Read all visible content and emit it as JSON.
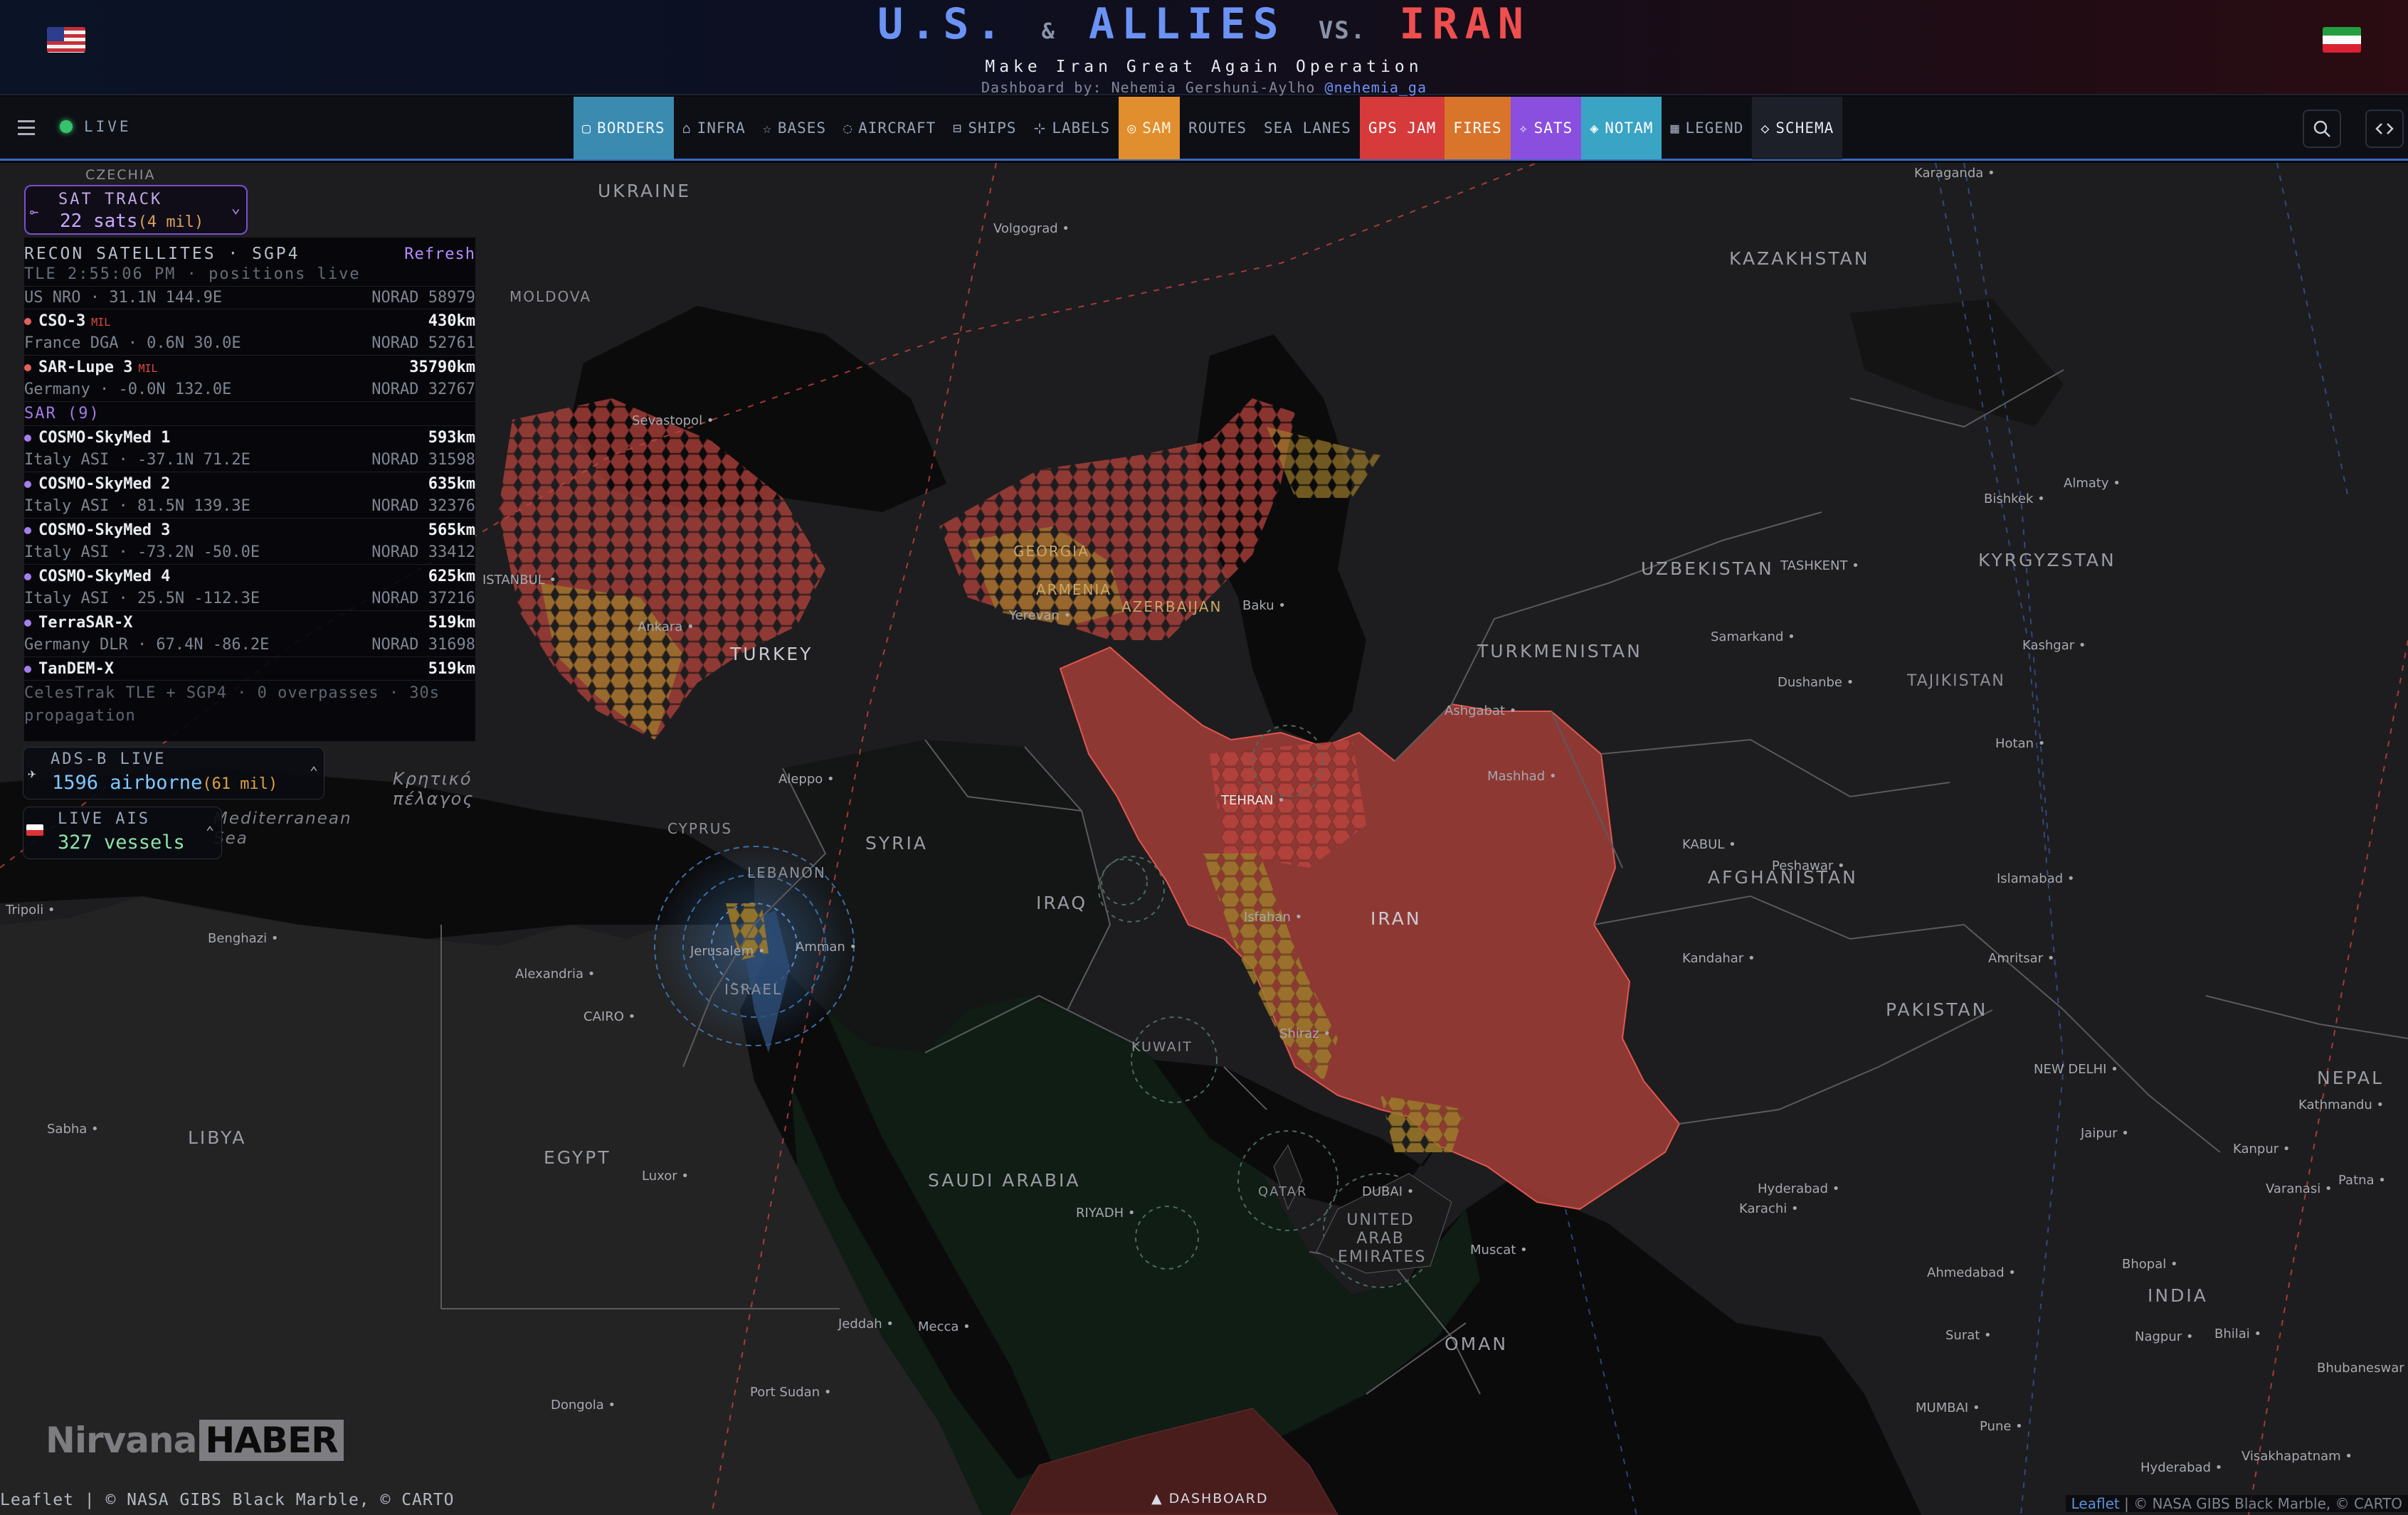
{
  "header": {
    "title_us": "U.S.",
    "title_amp": "&",
    "title_allies": "ALLIES",
    "title_vs": "VS.",
    "title_iran": "IRAN",
    "subtitle": "Make Iran Great Again Operation",
    "byline_prefix": "Dashboard by: Nehemia Gershuni-Aylho",
    "byline_handle": "@nehemia_ga"
  },
  "toolbar": {
    "live": "LIVE",
    "tabs": [
      {
        "label": "BORDERS",
        "icon": "▢"
      },
      {
        "label": "INFRA",
        "icon": "⌂"
      },
      {
        "label": "BASES",
        "icon": "☆"
      },
      {
        "label": "AIRCRAFT",
        "icon": "◌"
      },
      {
        "label": "SHIPS",
        "icon": "⊟"
      },
      {
        "label": "LABELS",
        "icon": "⊹"
      },
      {
        "label": "SAM",
        "icon": "◎"
      },
      {
        "label": "ROUTES",
        "icon": ""
      },
      {
        "label": "SEA LANES",
        "icon": ""
      },
      {
        "label": "GPS JAM",
        "icon": ""
      },
      {
        "label": "FIRES",
        "icon": ""
      },
      {
        "label": "SATS",
        "icon": "✧"
      },
      {
        "label": "NOTAM",
        "icon": "◈"
      },
      {
        "label": "LEGEND",
        "icon": "▦"
      },
      {
        "label": "SCHEMA",
        "icon": "◇"
      }
    ],
    "search_icon": "search-icon",
    "code_icon": "code-icon"
  },
  "sat_track": {
    "label": "SAT TRACK",
    "count": "22 sats",
    "mil": "(4 mil)"
  },
  "recon": {
    "title": "RECON SATELLITES · SGP4",
    "refresh": "Refresh",
    "tle": "TLE 2:55:06 PM · positions live",
    "top": {
      "detail": "US NRO · 31.1N 144.9E",
      "norad": "NORAD 58979"
    },
    "mil_sats": [
      {
        "name": "CSO-3",
        "tag": "MIL",
        "km": "430km",
        "detail": "France DGA · 0.6N 30.0E",
        "norad": "NORAD 52761"
      },
      {
        "name": "SAR-Lupe 3",
        "tag": "MIL",
        "km": "35790km",
        "detail": "Germany · -0.0N 132.0E",
        "norad": "NORAD 32767"
      }
    ],
    "sar_header": "SAR (9)",
    "sar_sats": [
      {
        "name": "COSMO-SkyMed 1",
        "km": "593km",
        "detail": "Italy ASI · -37.1N 71.2E",
        "norad": "NORAD 31598"
      },
      {
        "name": "COSMO-SkyMed 2",
        "km": "635km",
        "detail": "Italy ASI · 81.5N 139.3E",
        "norad": "NORAD 32376"
      },
      {
        "name": "COSMO-SkyMed 3",
        "km": "565km",
        "detail": "Italy ASI · -73.2N -50.0E",
        "norad": "NORAD 33412"
      },
      {
        "name": "COSMO-SkyMed 4",
        "km": "625km",
        "detail": "Italy ASI · 25.5N -112.3E",
        "norad": "NORAD 37216"
      },
      {
        "name": "TerraSAR-X",
        "km": "519km",
        "detail": "Germany DLR · 67.4N -86.2E",
        "norad": "NORAD 31698"
      },
      {
        "name": "TanDEM-X",
        "km": "519km"
      }
    ],
    "footer": "CelesTrak TLE + SGP4 · 0 overpasses · 30s propagation"
  },
  "adsb": {
    "label": "ADS-B LIVE",
    "count": "1596 airborne",
    "mil": "(61 mil)"
  },
  "ais": {
    "label": "LIVE AIS",
    "count": "327 vessels"
  },
  "map": {
    "countries": [
      "UKRAINE",
      "CZECHIA",
      "MOLDOVA",
      "KAZAKHSTAN",
      "UZBEKISTAN",
      "TURKMENISTAN",
      "KYRGYZSTAN",
      "TAJIKISTAN",
      "AFGHANISTAN",
      "PAKISTAN",
      "TURKEY",
      "GEORGIA",
      "ARMENIA",
      "AZERBAIJAN",
      "SYRIA",
      "IRAQ",
      "IRAN",
      "LEBANON",
      "ISRAEL",
      "CYPRUS",
      "KUWAIT",
      "QATAR",
      "UNITED ARAB EMIRATES",
      "SAUDI ARABIA",
      "OMAN",
      "EGYPT",
      "LIBYA",
      "INDIA",
      "NEPAL"
    ],
    "cities": [
      "Volgograd",
      "Karaganda",
      "Sevastopol",
      "Ankara",
      "ISTANBUL",
      "Yerevan",
      "Baku",
      "Bishkek",
      "Almaty",
      "TASHKENT",
      "Samarkand",
      "Dushanbe",
      "Kashgar",
      "Ashgabat",
      "Mashhad",
      "TEHRAN",
      "Isfahan",
      "Shiraz",
      "Aleppo",
      "Jerusalem",
      "Amman",
      "Alexandria",
      "CAIRO",
      "Tripoli",
      "Benghazi",
      "Sabha",
      "Luxor",
      "RIYADH",
      "Jeddah",
      "Mecca",
      "Port Sudan",
      "Dongola",
      "DUBAI",
      "Muscat",
      "KABUL",
      "Peshawar",
      "Islamabad",
      "Kandahar",
      "Amritsar",
      "NEW DELHI",
      "Kathmandu",
      "Jaipur",
      "Kanpur",
      "Patna",
      "Varanasi",
      "Hyderabad",
      "Karachi",
      "Ahmedabad",
      "Bhopal",
      "Surat",
      "Nagpur",
      "Bhilai",
      "Bhubaneswar",
      "MUMBAI",
      "Pune",
      "Hyderabad",
      "Visakhapatnam",
      "Hotan"
    ],
    "sea": "Mediterranean Sea",
    "greek_sea": "Κρητικό πέλαγος",
    "watermark_a": "Nirvana",
    "watermark_b": "HABER",
    "attr_left": "Leaflet | © NASA GIBS Black Marble, © CARTO",
    "attr_right_leaflet": "Leaflet",
    "attr_right_rest": "| © NASA GIBS Black Marble, © CARTO",
    "dashboard_btn": "▲ DASHBOARD"
  }
}
